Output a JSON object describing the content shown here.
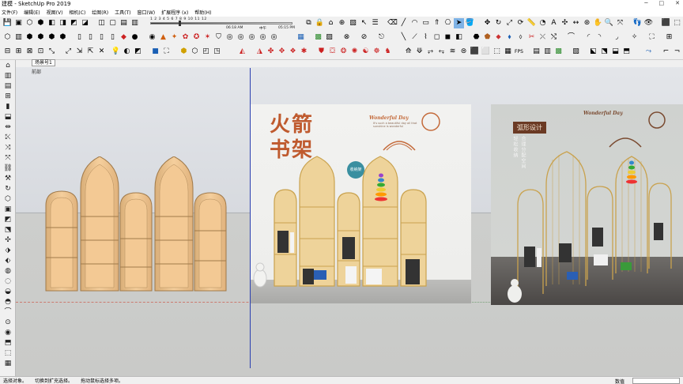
{
  "app": {
    "title": "建模 - SketchUp Pro 2019"
  },
  "window_controls": [
    "─",
    "□",
    "✕"
  ],
  "menu": {
    "items": [
      "文件(F)",
      "编辑(E)",
      "视图(V)",
      "相机(C)",
      "绘图(R)",
      "工具(T)",
      "窗口(W)",
      "扩展程序 (x)",
      "帮助(H)"
    ]
  },
  "shadow": {
    "scale": "1 2 3 4 5 6 7 8 9 10 11 12",
    "time_start": "06:18 AM",
    "time_label": "中午",
    "time_end": "05:15 PM"
  },
  "viewport": {
    "scene_tab": "场景号1",
    "layer_label": "前部"
  },
  "photo1": {
    "title_line1": "火箭",
    "title_line2": "书架",
    "en_title": "Wonderful Day",
    "en_sub": "It's such a beautiful day all that sunshine is wonderful",
    "badge": "收纳架"
  },
  "photo2": {
    "en_title": "Wonderful Day",
    "title": "弧形设计",
    "vert1": "合理分配空间",
    "vert2": "轻松收纳"
  },
  "status": {
    "left1": "选择对象。",
    "left2": "切换到扩充选择。",
    "left3": "拖动鼠标选择多项。",
    "right_label": "数值"
  },
  "colors": {
    "viewport_sky": "#e4e6ea",
    "viewport_ground": "#c9cac8",
    "shelf_wood": "#f3c994",
    "shelf_edge": "#b08a5a",
    "axis_blue": "#2a3fb0",
    "accent_orange": "#bf5a2e"
  }
}
